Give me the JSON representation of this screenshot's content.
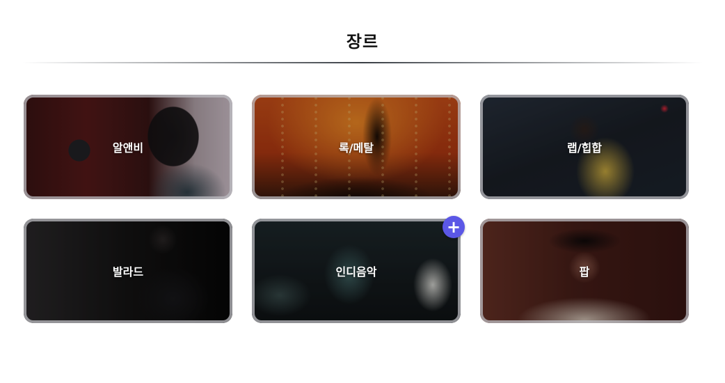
{
  "section": {
    "title": "장르"
  },
  "genres": [
    {
      "label": "알앤비",
      "icon": "photo-rnb-singer"
    },
    {
      "label": "록/메탈",
      "icon": "photo-rock-concert"
    },
    {
      "label": "랩/힙합",
      "icon": "photo-hiphop-performer"
    },
    {
      "label": "발라드",
      "icon": "photo-ballad-singer"
    },
    {
      "label": "인디음악",
      "icon": "photo-indie-band"
    },
    {
      "label": "팝",
      "icon": "photo-pop-dancer"
    }
  ],
  "add_button": {
    "icon": "plus-icon",
    "glyph": "+",
    "color": "#5b57e6"
  }
}
